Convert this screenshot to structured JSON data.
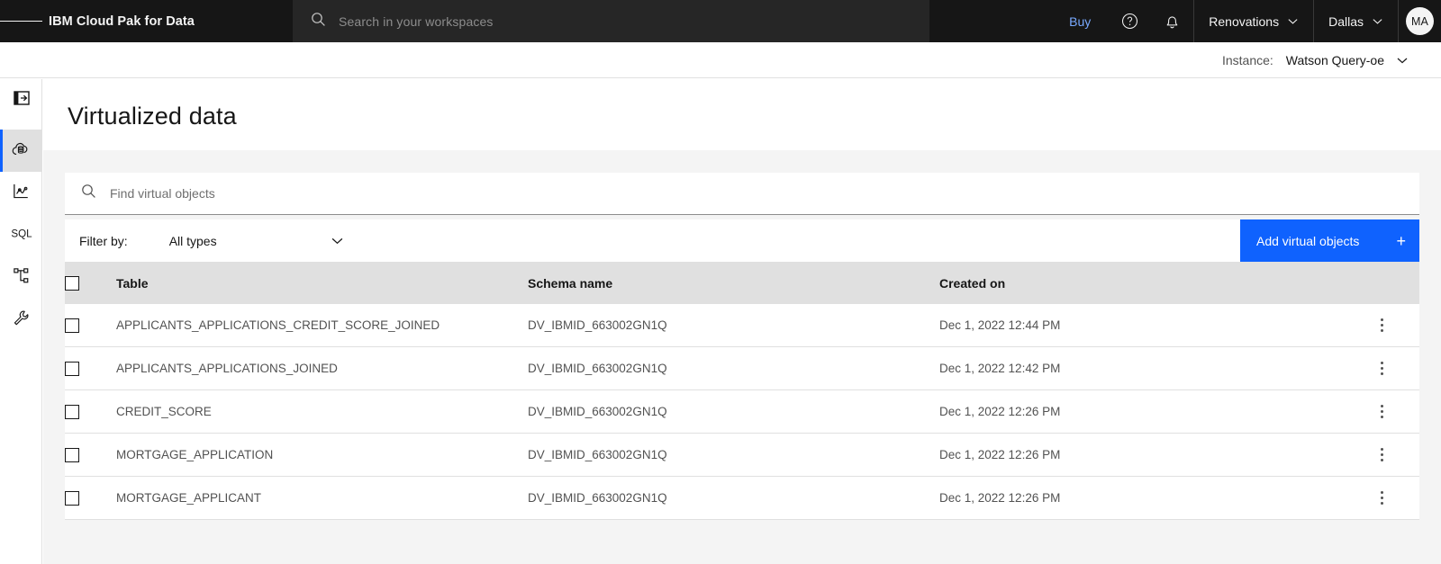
{
  "header": {
    "menu_icon": "hamburger-menu-icon",
    "brand": "IBM Cloud Pak for Data",
    "search": {
      "icon": "search-icon",
      "placeholder": "Search in your workspaces",
      "value": ""
    },
    "buy_label": "Buy",
    "help_icon": "help-circle-icon",
    "notifications_icon": "bell-icon",
    "project_dropdown": "Renovations",
    "region_dropdown": "Dallas",
    "avatar_initials": "MA",
    "background": "#161616",
    "search_background": "#262626",
    "buy_color": "#78a9ff"
  },
  "instance_bar": {
    "label": "Instance:",
    "value": "Watson Query-oe",
    "chevron_icon": "chevron-down-icon"
  },
  "sidebar": {
    "items": [
      {
        "icon": "panel-expand-icon",
        "active": false
      },
      {
        "icon": "cloud-database-icon",
        "active": true
      },
      {
        "icon": "analytics-chart-icon",
        "active": false
      },
      {
        "icon": "sql-icon",
        "active": false
      },
      {
        "icon": "hierarchy-schema-icon",
        "active": false
      },
      {
        "icon": "wrench-tools-icon",
        "active": false
      }
    ],
    "active_accent": "#0f62fe"
  },
  "main": {
    "page_title": "Virtualized data",
    "search": {
      "icon": "search-icon",
      "placeholder": "Find virtual objects",
      "value": ""
    },
    "toolbar": {
      "filter_label": "Filter by:",
      "filter_value": "All types",
      "filter_chevron_icon": "chevron-down-icon",
      "add_button_label": "Add virtual objects",
      "add_button_icon": "plus-icon",
      "add_button_color": "#0f62fe"
    },
    "table": {
      "select_all_icon": "checkbox-icon",
      "columns": [
        "Table",
        "Schema name",
        "Created on"
      ],
      "rows": [
        {
          "name": "APPLICANTS_APPLICATIONS_CREDIT_SCORE_JOINED",
          "schema": "DV_IBMID_663002GN1Q",
          "created": "Dec 1, 2022 12:44 PM",
          "menu_icon": "overflow-menu-icon"
        },
        {
          "name": "APPLICANTS_APPLICATIONS_JOINED",
          "schema": "DV_IBMID_663002GN1Q",
          "created": "Dec 1, 2022 12:42 PM",
          "menu_icon": "overflow-menu-icon"
        },
        {
          "name": "CREDIT_SCORE",
          "schema": "DV_IBMID_663002GN1Q",
          "created": "Dec 1, 2022 12:26 PM",
          "menu_icon": "overflow-menu-icon"
        },
        {
          "name": "MORTGAGE_APPLICATION",
          "schema": "DV_IBMID_663002GN1Q",
          "created": "Dec 1, 2022 12:26 PM",
          "menu_icon": "overflow-menu-icon"
        },
        {
          "name": "MORTGAGE_APPLICANT",
          "schema": "DV_IBMID_663002GN1Q",
          "created": "Dec 1, 2022 12:26 PM",
          "menu_icon": "overflow-menu-icon"
        }
      ]
    }
  }
}
